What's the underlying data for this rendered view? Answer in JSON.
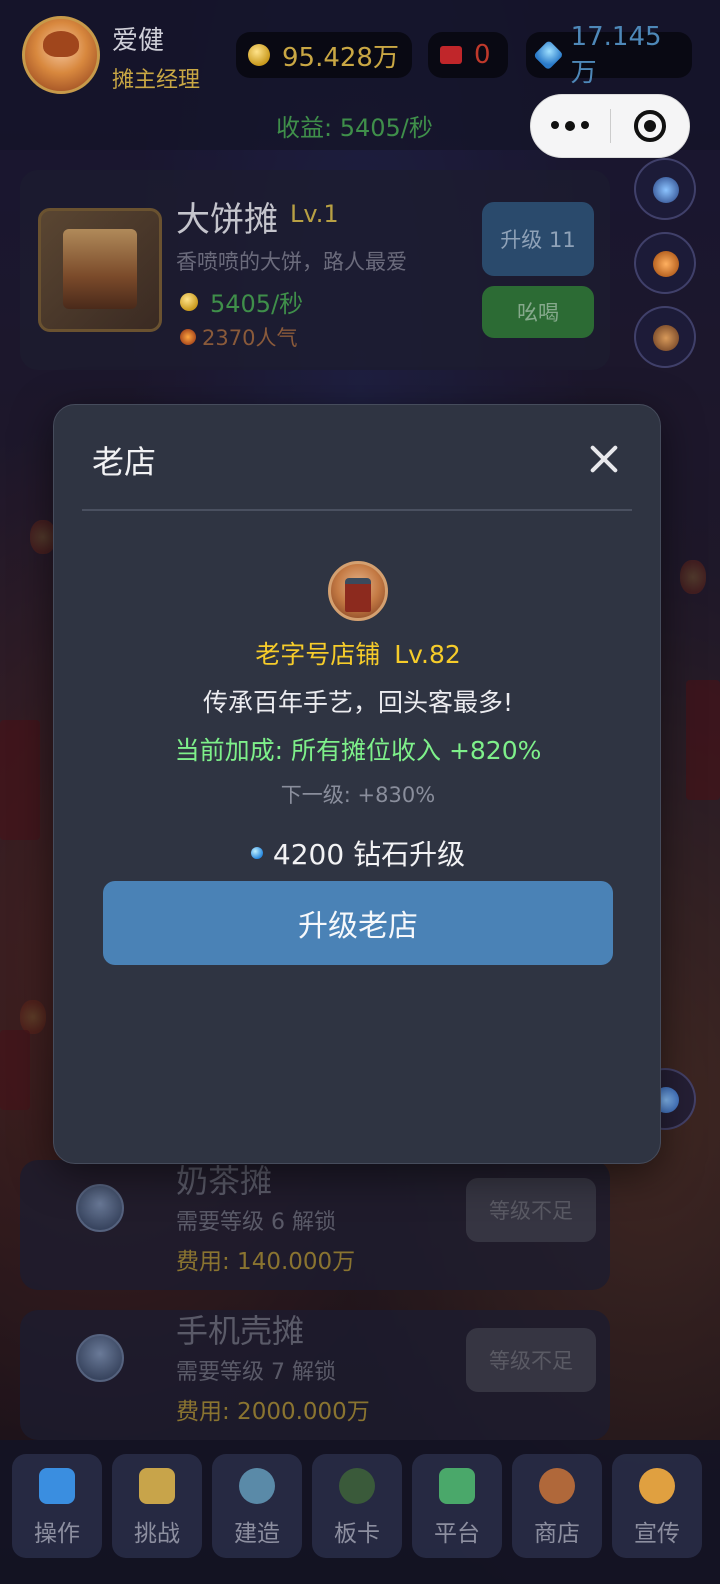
{
  "header": {
    "user_name": "爱健",
    "user_role": "摊主经理",
    "coins": "95.428万",
    "tickets": "0",
    "gems": "17.145万",
    "income": "收益: 5405/秒"
  },
  "stalls": {
    "active": {
      "name": "大饼摊",
      "level": "Lv.1",
      "desc": "香喷喷的大饼，路人最爱",
      "rate": "5405/秒",
      "popularity": "2370人气",
      "upgrade_label": "升级 11",
      "call_label": "吆喝"
    },
    "locked": [
      {
        "name": "奶茶摊",
        "req": "需要等级 6 解锁",
        "cost": "费用: 140.000万",
        "btn": "等级不足"
      },
      {
        "name": "手机壳摊",
        "req": "需要等级 7 解锁",
        "cost": "费用: 2000.000万",
        "btn": "等级不足"
      }
    ]
  },
  "modal": {
    "title": "老店",
    "shop_name": "老字号店铺",
    "shop_level": "Lv.82",
    "desc": "传承百年手艺，回头客最多!",
    "bonus": "当前加成: 所有摊位收入 +820%",
    "next": "下一级: +830%",
    "cost": "4200 钻石升级",
    "button": "升级老店"
  },
  "nav": {
    "items": [
      {
        "label": "操作",
        "icon": "dice-icon"
      },
      {
        "label": "挑战",
        "icon": "challenge-icon"
      },
      {
        "label": "建造",
        "icon": "build-icon"
      },
      {
        "label": "板卡",
        "icon": "card-icon"
      },
      {
        "label": "平台",
        "icon": "platform-icon"
      },
      {
        "label": "商店",
        "icon": "shop-icon"
      },
      {
        "label": "宣传",
        "icon": "promo-icon"
      }
    ]
  },
  "colors": {
    "accent": "#4a82b6",
    "gold": "#f6cc2a",
    "bonus_green": "#7ef08a",
    "modal_bg": "#2f3442"
  }
}
